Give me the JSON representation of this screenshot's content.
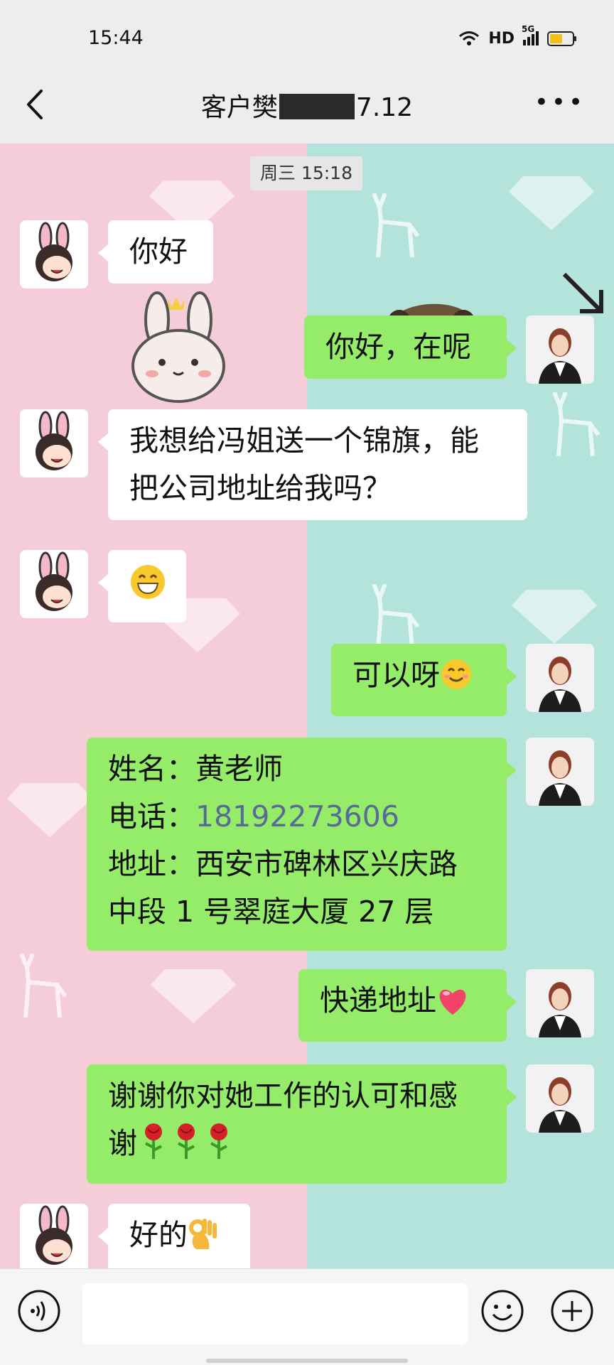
{
  "status_bar": {
    "time": "15:44",
    "network_label": "HD",
    "signal_label": "5G",
    "battery_percent": 60
  },
  "header": {
    "title_prefix": "客户樊",
    "title_suffix": "7.12",
    "back_icon": "chevron-left-icon",
    "more_icon": "more-dots-icon"
  },
  "chat": {
    "timestamp": "周三 15:18",
    "messages": [
      {
        "side": "left",
        "sender": "customer",
        "lines": [
          "你好"
        ]
      },
      {
        "side": "right",
        "sender": "me",
        "lines": [
          "你好，在呢"
        ]
      },
      {
        "side": "left",
        "sender": "customer",
        "lines": [
          "我想给冯姐送一个锦旗，能",
          "把公司地址给我吗？"
        ]
      },
      {
        "side": "left",
        "sender": "customer",
        "emoji": "grinning-face-emoji"
      },
      {
        "side": "right",
        "sender": "me",
        "text": "可以呀",
        "emoji": "smiling-face-emoji"
      },
      {
        "side": "right",
        "sender": "me",
        "name_label": "姓名：黄老师",
        "phone_label": "电话：",
        "phone": "18192273606",
        "address_line1": "地址：西安市碑林区兴庆路",
        "address_line2": "中段 1 号翠庭大厦 27 层"
      },
      {
        "side": "right",
        "sender": "me",
        "text": "快递地址",
        "emoji": "red-heart-emoji"
      },
      {
        "side": "right",
        "sender": "me",
        "line1": "谢谢你对她工作的认可和感",
        "line2": "谢",
        "emoji": "rose-emoji"
      },
      {
        "side": "left",
        "sender": "customer",
        "text": "好的",
        "emoji": "ok-hand-emoji"
      }
    ]
  },
  "input_bar": {
    "voice_icon": "voice-icon",
    "emoji_icon": "emoji-icon",
    "plus_icon": "plus-icon",
    "input_value": ""
  },
  "colors": {
    "my_bubble": "#95ec69",
    "their_bubble": "#ffffff",
    "link": "#576b95",
    "bg_left": "#f4cdd8",
    "bg_right": "#b4e3dc"
  }
}
